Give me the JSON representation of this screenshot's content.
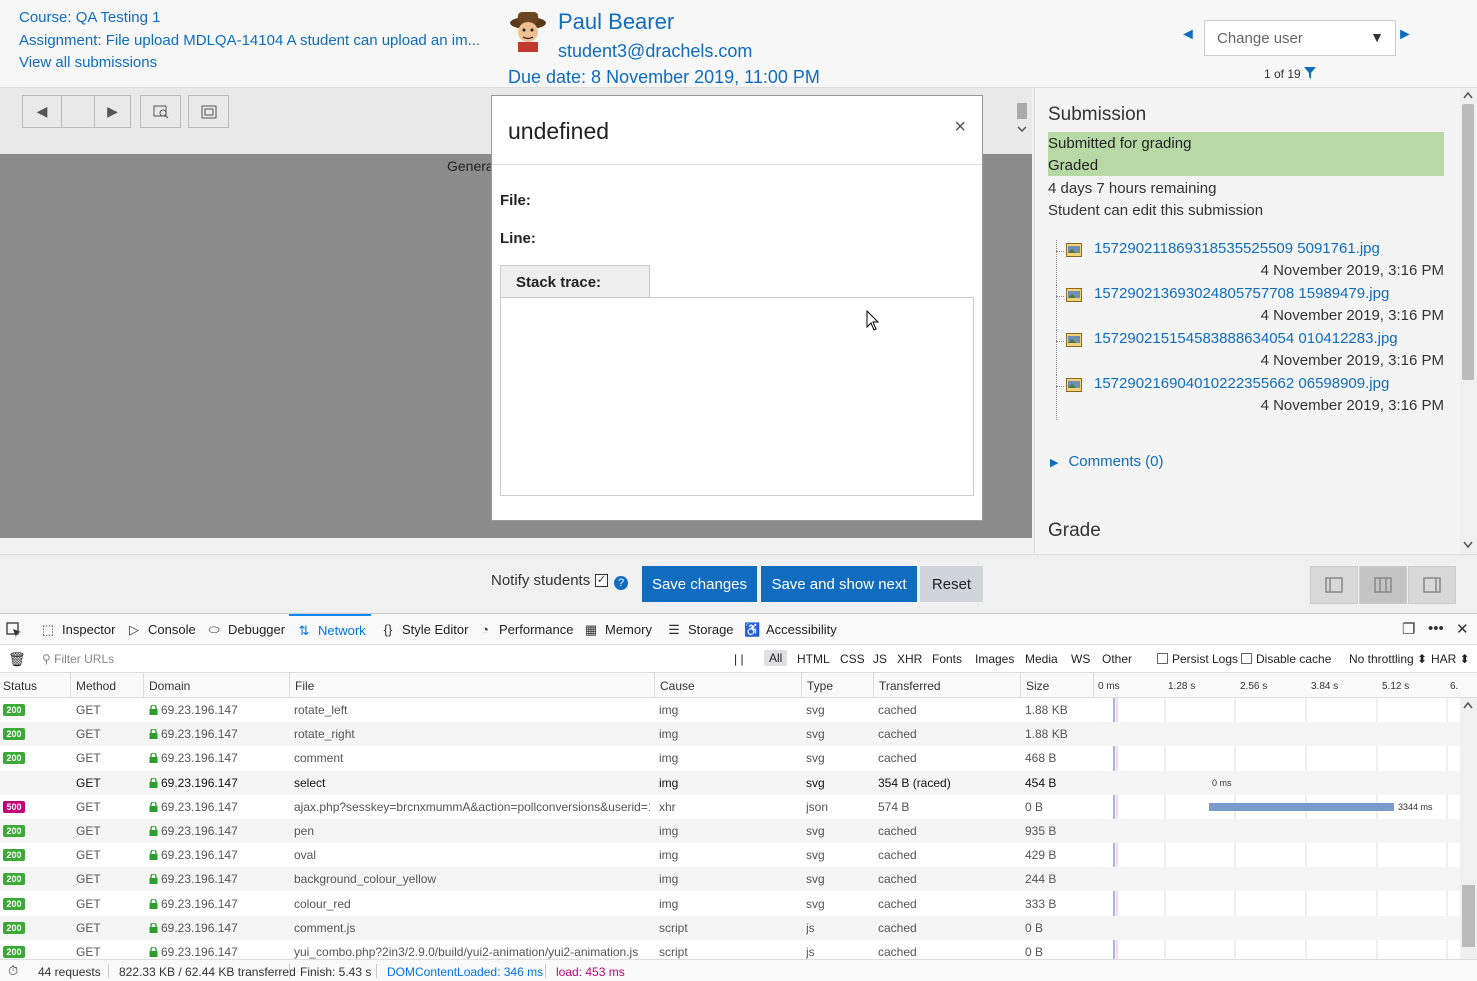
{
  "header": {
    "course": "Course: QA Testing 1",
    "assignment": "Assignment: File upload MDLQA-14104 A student can upload an im...",
    "view_all": "View all submissions",
    "user_name": "Paul Bearer",
    "user_email": "student3@drachels.com",
    "due_date": "Due date: 8 November 2019, 11:00 PM",
    "change_user": "Change user",
    "page_count": "1 of 19",
    "prev_arrow": "◄",
    "next_arrow": "►"
  },
  "toolbar": {
    "prev": "◀",
    "next": "▶"
  },
  "general_text": "Genera",
  "submission": {
    "title": "Submission",
    "status1": "Submitted for grading",
    "status2": "Graded",
    "time_remaining": "4 days 7 hours remaining",
    "edit_note": "Student can edit this submission",
    "files": [
      {
        "name": "157290211869318535525509 5091761.jpg",
        "date": "4 November 2019, 3:16 PM"
      },
      {
        "name": "157290213693024805757708 15989479.jpg",
        "date": "4 November 2019, 3:16 PM"
      },
      {
        "name": "157290215154583888634054 010412283.jpg",
        "date": "4 November 2019, 3:16 PM"
      },
      {
        "name": "157290216904010222355662 06598909.jpg",
        "date": "4 November 2019, 3:16 PM"
      }
    ],
    "comments": "Comments (0)",
    "grade_title": "Grade"
  },
  "bottom": {
    "notify_label": "Notify students",
    "save_changes": "Save changes",
    "save_next": "Save and show next",
    "reset": "Reset"
  },
  "modal": {
    "title": "undefined",
    "close": "×",
    "file_label": "File:",
    "line_label": "Line:",
    "stack_label": "Stack trace:"
  },
  "devtools": {
    "tabs": [
      "Inspector",
      "Console",
      "Debugger",
      "Network",
      "Style Editor",
      "Performance",
      "Memory",
      "Storage",
      "Accessibility"
    ],
    "active_tab": "Network",
    "filter_placeholder": "Filter URLs",
    "filters": [
      "All",
      "HTML",
      "CSS",
      "JS",
      "XHR",
      "Fonts",
      "Images",
      "Media",
      "WS",
      "Other"
    ],
    "persist_logs": "Persist Logs",
    "disable_cache": "Disable cache",
    "throttling": "No throttling ⬍",
    "har": "HAR ⬍",
    "pause": "| |",
    "columns": [
      "Status",
      "Method",
      "Domain",
      "File",
      "Cause",
      "Type",
      "Transferred",
      "Size"
    ],
    "timeline_ticks": [
      "0 ms",
      "1.28 s",
      "2.56 s",
      "3.84 s",
      "5.12 s",
      "6."
    ],
    "rows": [
      {
        "status": "200",
        "method": "GET",
        "domain": "69.23.196.147",
        "file": "rotate_left",
        "cause": "img",
        "type": "svg",
        "transferred": "cached",
        "size": "1.88 KB",
        "timing": ""
      },
      {
        "status": "200",
        "method": "GET",
        "domain": "69.23.196.147",
        "file": "rotate_right",
        "cause": "img",
        "type": "svg",
        "transferred": "cached",
        "size": "1.88 KB",
        "timing": ""
      },
      {
        "status": "200",
        "method": "GET",
        "domain": "69.23.196.147",
        "file": "comment",
        "cause": "img",
        "type": "svg",
        "transferred": "cached",
        "size": "468 B",
        "timing": ""
      },
      {
        "status": "",
        "method": "GET",
        "domain": "69.23.196.147",
        "file": "select",
        "cause": "img",
        "type": "svg",
        "transferred": "354 B (raced)",
        "size": "454 B",
        "timing": "0 ms"
      },
      {
        "status": "500",
        "method": "GET",
        "domain": "69.23.196.147",
        "file": "ajax.php?sesskey=brcnxmummA&action=pollconversions&userid=1...",
        "cause": "xhr",
        "type": "json",
        "transferred": "574 B",
        "size": "0 B",
        "timing": "3344 ms"
      },
      {
        "status": "200",
        "method": "GET",
        "domain": "69.23.196.147",
        "file": "pen",
        "cause": "img",
        "type": "svg",
        "transferred": "cached",
        "size": "935 B",
        "timing": ""
      },
      {
        "status": "200",
        "method": "GET",
        "domain": "69.23.196.147",
        "file": "oval",
        "cause": "img",
        "type": "svg",
        "transferred": "cached",
        "size": "429 B",
        "timing": ""
      },
      {
        "status": "200",
        "method": "GET",
        "domain": "69.23.196.147",
        "file": "background_colour_yellow",
        "cause": "img",
        "type": "svg",
        "transferred": "cached",
        "size": "244 B",
        "timing": ""
      },
      {
        "status": "200",
        "method": "GET",
        "domain": "69.23.196.147",
        "file": "colour_red",
        "cause": "img",
        "type": "svg",
        "transferred": "cached",
        "size": "333 B",
        "timing": ""
      },
      {
        "status": "200",
        "method": "GET",
        "domain": "69.23.196.147",
        "file": "comment.js",
        "cause": "script",
        "type": "js",
        "transferred": "cached",
        "size": "0 B",
        "timing": ""
      },
      {
        "status": "200",
        "method": "GET",
        "domain": "69.23.196.147",
        "file": "yui_combo.php?2in3/2.9.0/build/yui2-animation/yui2-animation.js",
        "cause": "script",
        "type": "js",
        "transferred": "cached",
        "size": "0 B",
        "timing": ""
      }
    ],
    "status_bar": {
      "requests": "44 requests",
      "transferred": "822.33 KB / 62.44 KB transferred",
      "finish": "Finish: 5.43 s",
      "dom_loaded": "DOMContentLoaded: 346 ms",
      "load": "load: 453 ms"
    }
  },
  "colors": {
    "link": "#0f6cbf",
    "status_green": "#b7d9a6",
    "badge_ok": "#3ba935",
    "badge_err": "#c40078",
    "dom_loaded": "#0074e8",
    "load": "#c40078"
  }
}
